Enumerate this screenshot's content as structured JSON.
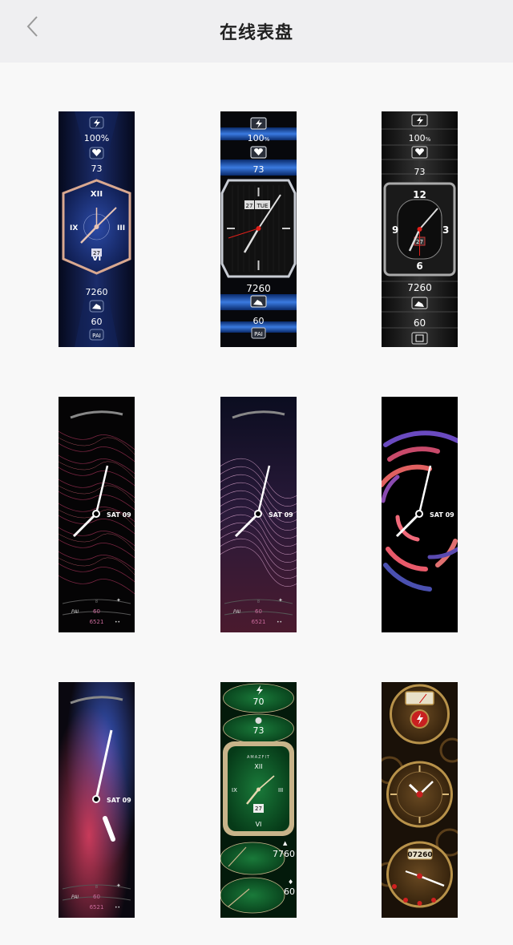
{
  "header": {
    "title": "在线表盘"
  },
  "faces": [
    {
      "battery": "100%",
      "heart": "73",
      "date": "27",
      "steps": "7260",
      "pai": "60",
      "pai_label": "PAI"
    },
    {
      "battery": "100",
      "battery_unit": "%",
      "heart": "73",
      "date_day": "27",
      "date_weekday": "TUE",
      "steps": "7260",
      "pai": "60",
      "pai_label": "PAI"
    },
    {
      "battery": "100",
      "battery_unit": "%",
      "heart": "73",
      "date": "27",
      "steps": "7260",
      "pai": "60"
    },
    {
      "date": "SAT 09",
      "pai_label": "PAI",
      "pai": "60",
      "steps": "6521"
    },
    {
      "date": "SAT 09",
      "pai_label": "PAI",
      "pai": "60",
      "steps": "6521"
    },
    {
      "date": "SAT 09"
    },
    {
      "date": "SAT 09",
      "pai_label": "PAI",
      "pai": "60",
      "steps": "6521"
    },
    {
      "battery": "70",
      "heart": "73",
      "brand": "AMAZFIT",
      "date": "27",
      "steps": "7760",
      "calories": "60"
    },
    {
      "steps": "07260"
    }
  ]
}
